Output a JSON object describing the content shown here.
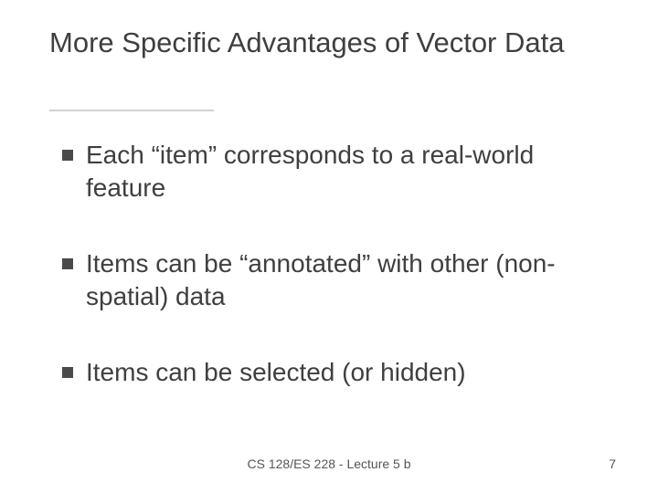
{
  "title": "More Specific Advantages of Vector Data",
  "bullets": [
    "Each “item” corresponds to a real-world feature",
    "Items can be “annotated” with other (non-spatial) data",
    "Items can be selected (or hidden)"
  ],
  "footer": {
    "center": "CS 128/ES 228 - Lecture 5 b",
    "page": "7"
  }
}
